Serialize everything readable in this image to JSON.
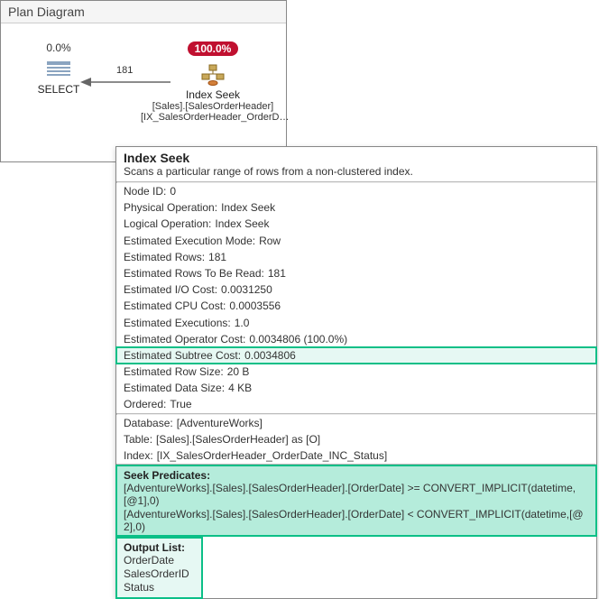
{
  "panelTitle": "Plan Diagram",
  "selectNode": {
    "pct": "0.0%",
    "label": "SELECT"
  },
  "seekNode": {
    "pct": "100.0%",
    "label": "Index Seek",
    "sub1": "[Sales].[SalesOrderHeader]",
    "sub2": "[IX_SalesOrderHeader_OrderD…"
  },
  "arrowRows": "181",
  "tooltip": {
    "title": "Index Seek",
    "desc": "Scans a particular range of rows from a non-clustered index.",
    "rows1": [
      {
        "k": "Node ID:",
        "v": "0"
      },
      {
        "k": "Physical Operation:",
        "v": "Index Seek"
      },
      {
        "k": "Logical Operation:",
        "v": "Index Seek"
      },
      {
        "k": "Estimated Execution Mode:",
        "v": "Row"
      },
      {
        "k": "Estimated Rows:",
        "v": "181"
      },
      {
        "k": "Estimated Rows To Be Read:",
        "v": "181"
      },
      {
        "k": "Estimated I/O Cost:",
        "v": "0.0031250"
      },
      {
        "k": "Estimated CPU Cost:",
        "v": "0.0003556"
      },
      {
        "k": "Estimated Executions:",
        "v": "1.0"
      },
      {
        "k": "Estimated Operator Cost:",
        "v": "0.0034806 (100.0%)"
      }
    ],
    "subtree": {
      "k": "Estimated Subtree Cost:",
      "v": "0.0034806"
    },
    "rows2": [
      {
        "k": "Estimated Row Size:",
        "v": "20 B"
      },
      {
        "k": "Estimated Data Size:",
        "v": "4 KB"
      },
      {
        "k": "Ordered:",
        "v": "True"
      }
    ],
    "rows3": [
      {
        "k": "Database:",
        "v": "[AdventureWorks]"
      },
      {
        "k": "Table:",
        "v": "[Sales].[SalesOrderHeader] as [O]"
      },
      {
        "k": "Index:",
        "v": "[IX_SalesOrderHeader_OrderDate_INC_Status]"
      }
    ],
    "seekPredTitle": "Seek Predicates:",
    "seekPredicates": [
      "[AdventureWorks].[Sales].[SalesOrderHeader].[OrderDate] >= CONVERT_IMPLICIT(datetime,[@1],0)",
      "[AdventureWorks].[Sales].[SalesOrderHeader].[OrderDate] < CONVERT_IMPLICIT(datetime,[@2],0)"
    ],
    "outputTitle": "Output List:",
    "outputCols": [
      "OrderDate",
      "SalesOrderID",
      "Status"
    ]
  }
}
